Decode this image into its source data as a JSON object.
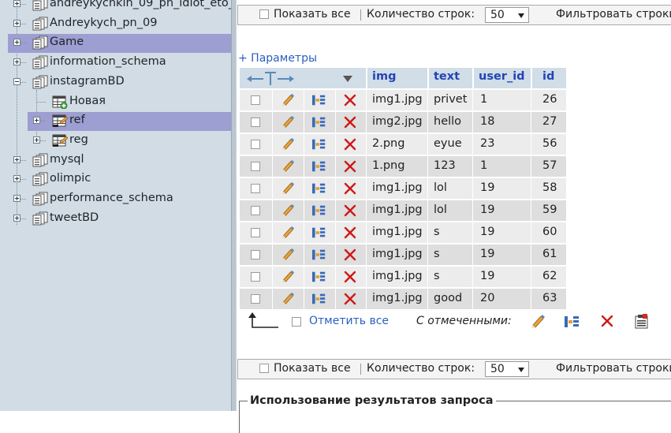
{
  "sidebar": {
    "items": [
      {
        "label": "andreykychkin_09_pn_idiot_eto_",
        "expander": "plus"
      },
      {
        "label": "Andreykych_pn_09",
        "expander": "plus"
      },
      {
        "label": "Game",
        "expander": "plus",
        "highlighted": true
      },
      {
        "label": "information_schema",
        "expander": "plus"
      },
      {
        "label": "instagramBD",
        "expander": "minus"
      },
      {
        "label": "Новая",
        "child": true,
        "icon": "new-table-icon"
      },
      {
        "label": "ref",
        "child": true,
        "expander": "plus",
        "icon": "table-icon",
        "highlighted": true
      },
      {
        "label": "reg",
        "child": true,
        "expander": "plus",
        "icon": "table-icon"
      },
      {
        "label": "mysql",
        "expander": "plus"
      },
      {
        "label": "olimpic",
        "expander": "plus"
      },
      {
        "label": "performance_schema",
        "expander": "plus"
      },
      {
        "label": "tweetBD",
        "expander": "plus"
      }
    ]
  },
  "nav_top": {
    "show_all": "Показать все",
    "rows_label": "Количество строк:",
    "rows_value": "50",
    "filter_label": "Фильтровать строки"
  },
  "params_link": "+ Параметры",
  "table": {
    "columns": [
      "img",
      "text",
      "user_id",
      "id"
    ],
    "rows": [
      [
        "img1.jpg",
        "privet",
        "1",
        "26"
      ],
      [
        "img2.jpg",
        "hello",
        "18",
        "27"
      ],
      [
        "2.png",
        "eyue",
        "23",
        "56"
      ],
      [
        "1.png",
        "123",
        "1",
        "57"
      ],
      [
        "img1.jpg",
        "lol",
        "19",
        "58"
      ],
      [
        "img1.jpg",
        "lol",
        "19",
        "59"
      ],
      [
        "img1.jpg",
        "s",
        "19",
        "60"
      ],
      [
        "img1.jpg",
        "s",
        "19",
        "61"
      ],
      [
        "img1.jpg",
        "s",
        "19",
        "62"
      ],
      [
        "img1.jpg",
        "good",
        "20",
        "63"
      ]
    ]
  },
  "bulk": {
    "check_all": "Отметить все",
    "with_selected": "С отмеченными:"
  },
  "nav_bottom": {
    "show_all": "Показать все",
    "rows_label": "Количество строк:",
    "rows_value": "50",
    "filter_label": "Фильтровать строки"
  },
  "usage_title": "Использование результатов запроса",
  "colors": {
    "sidebar_bg": "#d1dce5",
    "highlight": "#9d9ed1",
    "link": "#2a5fbf",
    "header_text": "#2344b5",
    "delete_red": "#d01818"
  }
}
